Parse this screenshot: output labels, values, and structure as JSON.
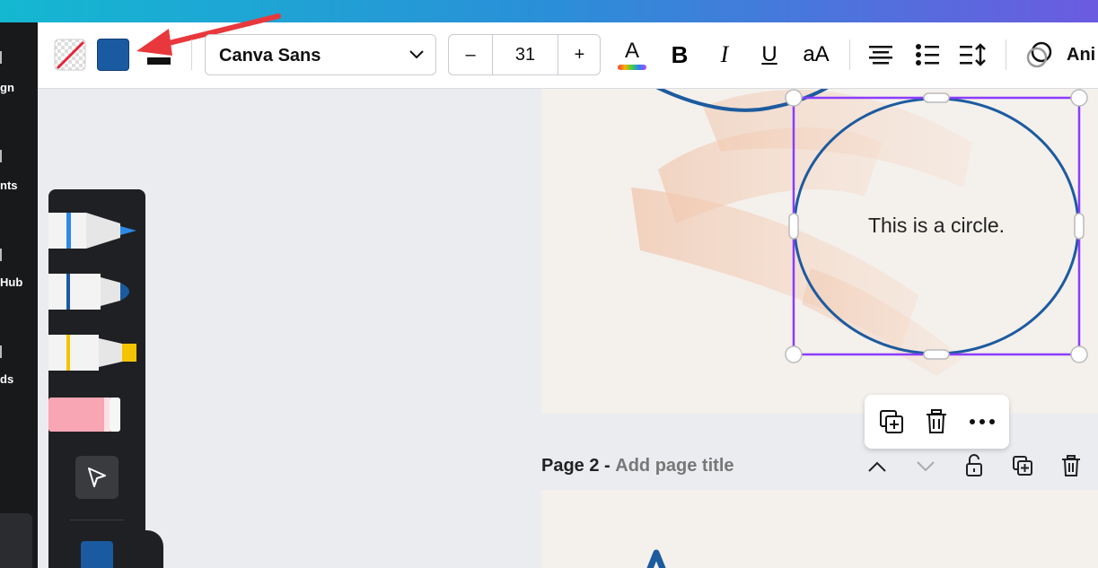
{
  "left_rail": {
    "labels": [
      "gn",
      "nts",
      "Hub",
      "ds"
    ]
  },
  "toolbar": {
    "font_name": "Canva Sans",
    "font_size": "31",
    "decrease_label": "–",
    "increase_label": "+",
    "text_color_letter": "A",
    "bold_label": "B",
    "italic_label": "I",
    "underline_label": "U",
    "case_label": "aA",
    "animate_label": "Ani",
    "fill_color": "#1a5aa0",
    "accent_selection": "#8b3dff",
    "arrow_color": "#e8383d"
  },
  "canvas": {
    "circle_text": "This is a circle.",
    "stroke_color": "#1d5b9f"
  },
  "page2": {
    "label": "Page 2 -",
    "title_placeholder": "Add page title"
  }
}
